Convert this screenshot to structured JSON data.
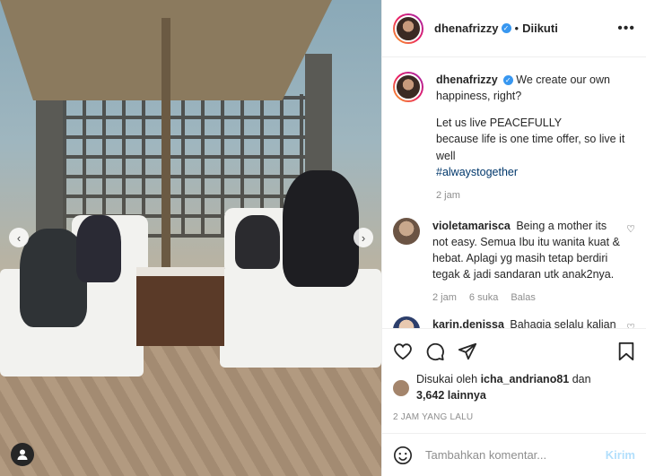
{
  "header": {
    "username": "dhenafrizzy",
    "dot": "•",
    "follow_status": "Diikuti",
    "more": "•••"
  },
  "caption": {
    "username": "dhenafrizzy",
    "line1": "We create our own happiness, right?",
    "line2": "Let us live PEACEFULLY",
    "line3": "because life is one time offer, so live it well",
    "hashtag": "#alwaystogether",
    "time": "2 jam"
  },
  "comments": [
    {
      "username": "violetamarisca",
      "text": "Being a mother its not easy. Semua Ibu itu wanita kuat & hebat. Aplagi yg masih tetap berdiri tegak & jadi sandaran utk anak2nya.",
      "time": "2 jam",
      "likes": "6 suka",
      "reply": "Balas"
    },
    {
      "username": "karin.denissa",
      "text": "Bahagia selalu kalian ❤",
      "time": "",
      "likes": "",
      "reply": ""
    }
  ],
  "likes": {
    "prefix": "Disukai oleh",
    "user": "icha_andriano81",
    "connector": "dan",
    "others": "3,642 lainnya"
  },
  "post_time": "2 JAM YANG LALU",
  "comment_box": {
    "placeholder": "Tambahkan komentar...",
    "send": "Kirim"
  },
  "nav": {
    "prev": "‹",
    "next": "›"
  },
  "icons": {
    "heart": "heart-icon",
    "comment": "comment-icon",
    "share": "share-icon",
    "bookmark": "bookmark-icon",
    "emoji": "emoji-icon",
    "tag": "user-tag-icon"
  },
  "colors": {
    "link": "#00376b",
    "verified": "#3897f0",
    "muted": "#8e8e8e"
  }
}
